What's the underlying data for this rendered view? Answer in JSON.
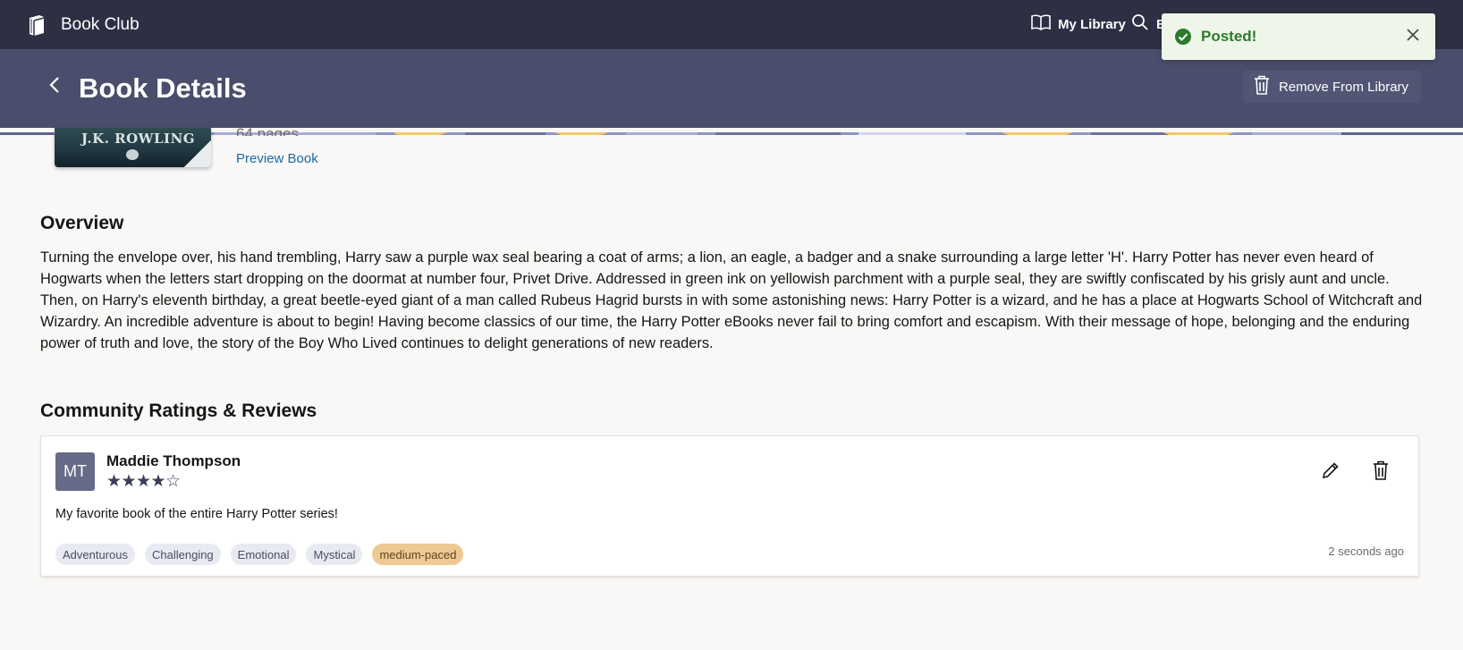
{
  "app": {
    "title": "Book Club",
    "icon": "book-stack-icon"
  },
  "nav": {
    "library_label": "My Library",
    "library_icon": "open-book-icon",
    "search_label": "E",
    "search_icon": "search-icon"
  },
  "header": {
    "title": "Book Details",
    "back_icon": "chevron-left-icon",
    "remove_label": "Remove From Library",
    "remove_icon": "trash-icon"
  },
  "book": {
    "cover_author": "J.K. ROWLING",
    "pages_text": "64 pages",
    "preview_label": "Preview Book"
  },
  "overview": {
    "title": "Overview",
    "text": "Turning the envelope over, his hand trembling, Harry saw a purple wax seal bearing a coat of arms; a lion, an eagle, a badger and a snake surrounding a large letter 'H'. Harry Potter has never even heard of Hogwarts when the letters start dropping on the doormat at number four, Privet Drive. Addressed in green ink on yellowish parchment with a purple seal, they are swiftly confiscated by his grisly aunt and uncle. Then, on Harry's eleventh birthday, a great beetle-eyed giant of a man called Rubeus Hagrid bursts in with some astonishing news: Harry Potter is a wizard, and he has a place at Hogwarts School of Witchcraft and Wizardry. An incredible adventure is about to begin! Having become classics of our time, the Harry Potter eBooks never fail to bring comfort and escapism. With their message of hope, belonging and the enduring power of truth and love, the story of the Boy Who Lived continues to delight generations of new readers."
  },
  "reviews": {
    "title": "Community Ratings & Reviews",
    "items": [
      {
        "initials": "MT",
        "name": "Maddie Thompson",
        "rating": 4,
        "rating_max": 5,
        "text": "My favorite book of the entire Harry Potter series!",
        "tags": [
          "Adventurous",
          "Challenging",
          "Emotional",
          "Mystical"
        ],
        "pace_tag": "medium-paced",
        "time": "2 seconds ago",
        "edit_icon": "pencil-icon",
        "delete_icon": "trash-icon"
      }
    ]
  },
  "toast": {
    "message": "Posted!",
    "status_icon": "check-circle-icon",
    "close_icon": "close-icon"
  },
  "colors": {
    "topbar": "#2d3043",
    "header": "#4a4d6b",
    "link": "#1b6aa5",
    "toast_success": "#2c7a2c",
    "pace_tag": "#efc994"
  }
}
